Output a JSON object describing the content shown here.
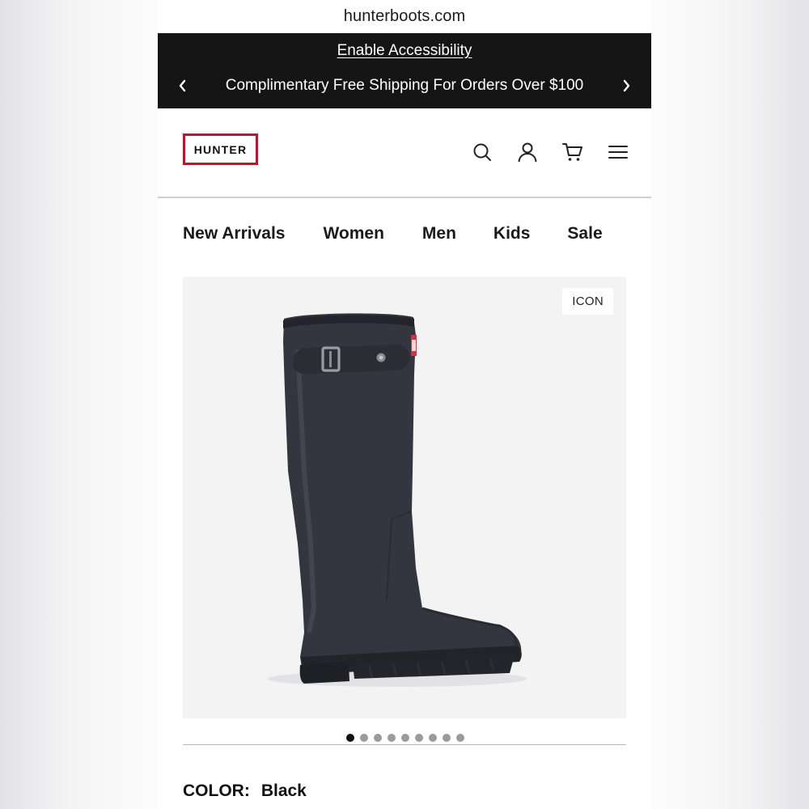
{
  "browser": {
    "url": "hunterboots.com"
  },
  "promo_bar": {
    "accessibility_link": "Enable Accessibility",
    "message": "Complimentary Free Shipping For Orders Over $100",
    "prev_icon": "chevron-left-icon",
    "next_icon": "chevron-right-icon"
  },
  "header": {
    "logo_text": "HUNTER",
    "brand_color": "#c8102e",
    "icons": [
      "search-icon",
      "account-icon",
      "cart-icon",
      "menu-icon"
    ]
  },
  "nav": {
    "items": [
      {
        "label": "New Arrivals"
      },
      {
        "label": "Women"
      },
      {
        "label": "Men"
      },
      {
        "label": "Kids"
      },
      {
        "label": "Sale"
      }
    ]
  },
  "product": {
    "badge": "ICON",
    "image_alt_icon": "rain-boot-image",
    "carousel": {
      "total": 9,
      "active": 1
    },
    "color_label": "COLOR:",
    "color_value": "Black"
  }
}
